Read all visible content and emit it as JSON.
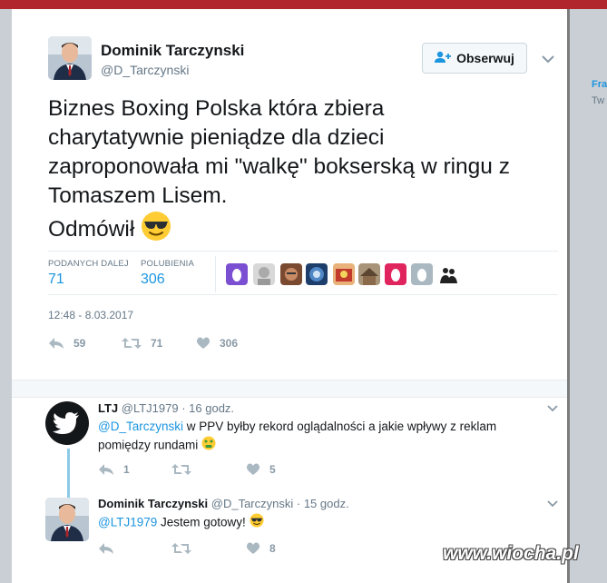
{
  "tweet": {
    "author_name": "Dominik Tarczynski",
    "author_handle": "@D_Tarczynski",
    "follow_label": "Obserwuj",
    "text_lines": [
      "Biznes Boxing Polska która zbiera",
      "charytatywnie pieniądze dla dzieci",
      "zaproponowała mi \"walkę\" bokserską w ringu z",
      "Tomaszem Lisem.",
      "Odmówił"
    ],
    "emoji": "smiling-face-with-sunglasses",
    "retweets_label": "PODANYCH DALEJ",
    "retweets_value": "71",
    "likes_label": "POLUBIENIA",
    "likes_value": "306",
    "timestamp": "12:48 - 8.03.2017",
    "actions": {
      "reply_count": "59",
      "retweet_count": "71",
      "like_count": "306"
    },
    "likers": [
      "egg-avatar-purple",
      "sketch-avatar",
      "face-avatar",
      "blue-avatar",
      "red-avatar",
      "house-avatar",
      "egg-avatar-pink",
      "egg-avatar-gray",
      "silhouette-avatar"
    ]
  },
  "replies": [
    {
      "name": "LTJ",
      "handle": "@LTJ1979",
      "time": "· 16 godz.",
      "mention": "@D_Tarczynski",
      "text_line1": " w PPV byłby rekord oglądalności a jakie wpływy z reklam",
      "text_line2": "pomiędzy rundami",
      "emoji": "money-mouth-face",
      "reply_count": "1",
      "retweet_count": "",
      "like_count": "5"
    },
    {
      "name": "Dominik Tarczynski",
      "handle": "@D_Tarczynski",
      "time": "· 15 godz.",
      "mention": "@LTJ1979",
      "text_line1": " Jestem gotowy!",
      "emoji": "smiling-face-with-sunglasses",
      "reply_count": "",
      "retweet_count": "",
      "like_count": "8"
    }
  ],
  "background": {
    "peek_1": "Fra",
    "peek_2": "Tw"
  },
  "watermark": "www.wiocha.pl",
  "colors": {
    "accent": "#1b95e0",
    "muted": "#657786",
    "twitter_bird_bg": "#14171a"
  }
}
